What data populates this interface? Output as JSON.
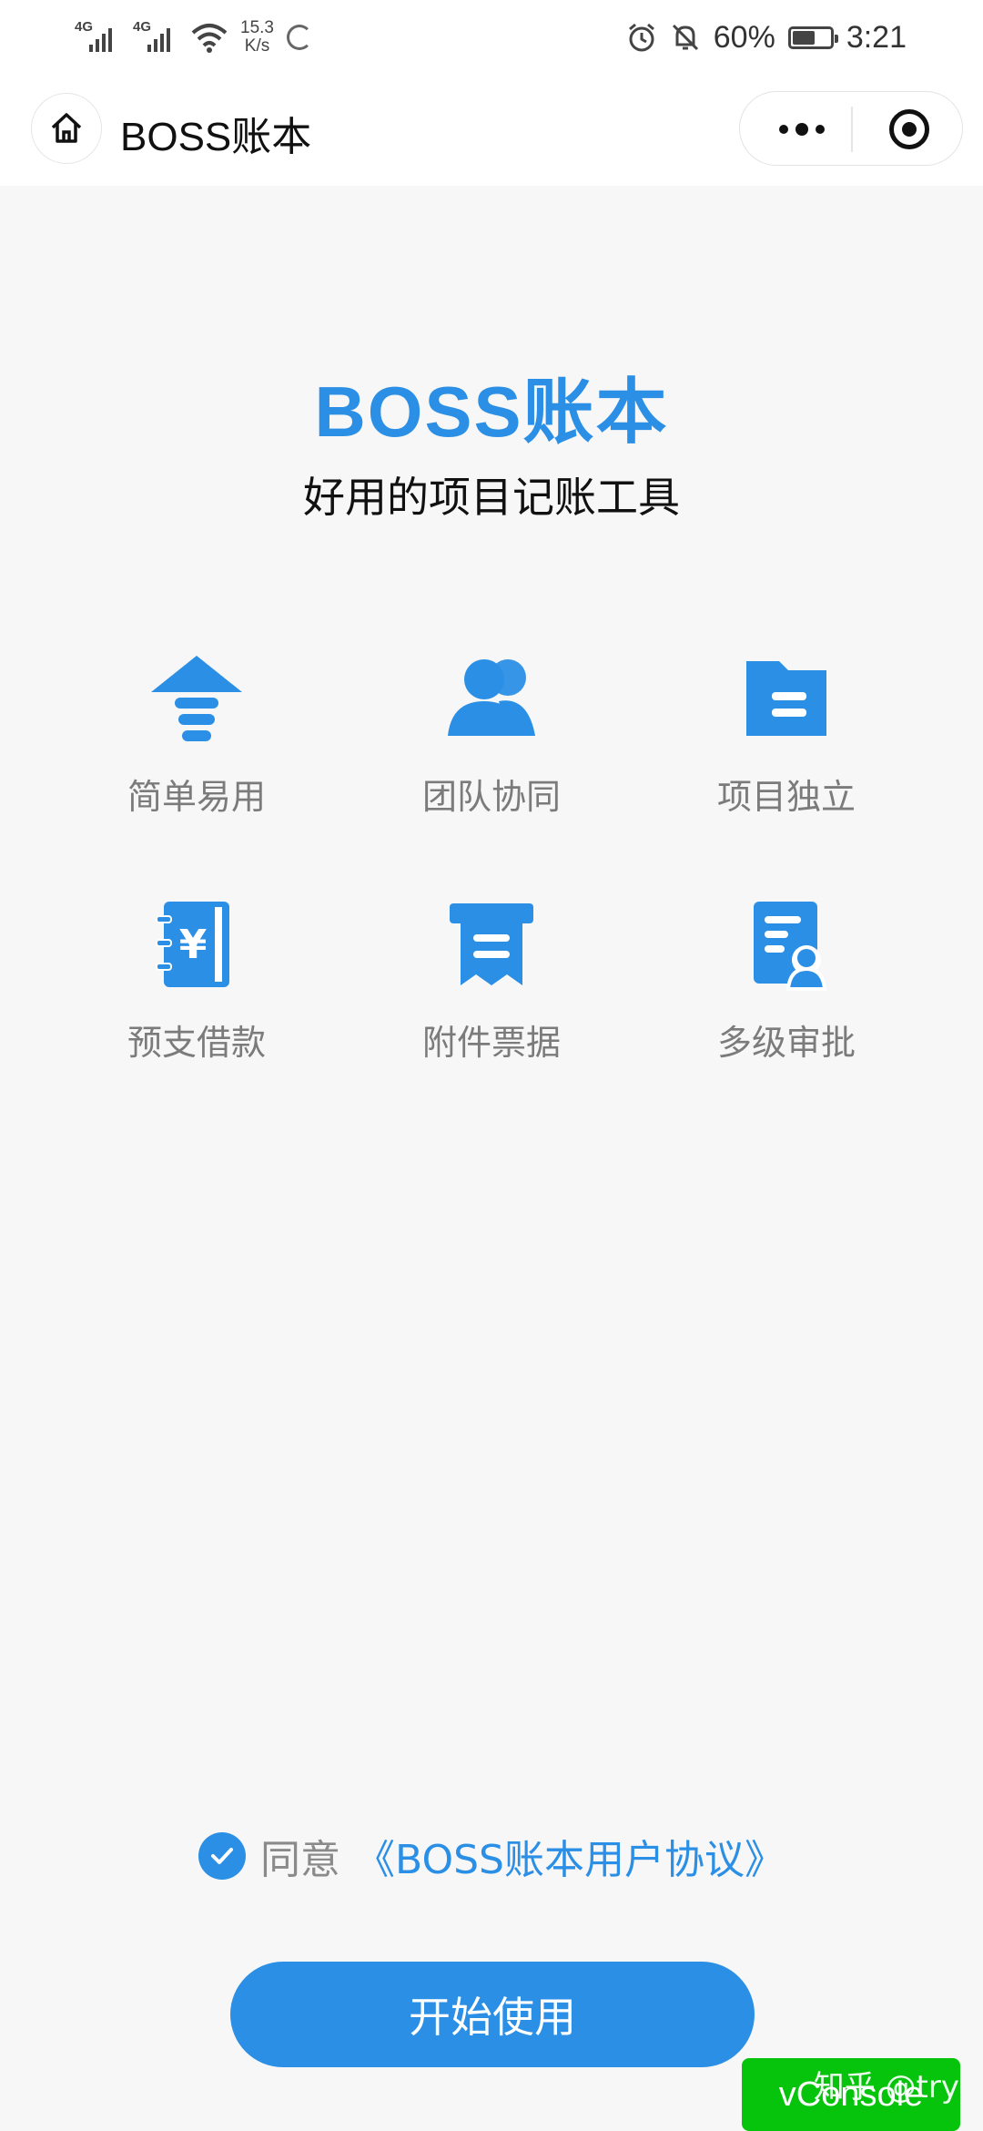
{
  "status_bar": {
    "network_1": "4G",
    "network_2": "4G",
    "speed_value": "15.3",
    "speed_unit": "K/s",
    "battery_percent": "60%",
    "battery_level": 0.6,
    "time": "3:21"
  },
  "nav": {
    "title": "BOSS账本",
    "home_icon": "home-icon",
    "more_icon": "more-dots-icon",
    "close_icon": "target-icon"
  },
  "header": {
    "brand": "BOSS账本",
    "slogan": "好用的项目记账工具"
  },
  "features": [
    {
      "label": "简单易用",
      "icon": "arrow-up-stack-icon"
    },
    {
      "label": "团队协同",
      "icon": "team-icon"
    },
    {
      "label": "项目独立",
      "icon": "folder-icon"
    },
    {
      "label": "预支借款",
      "icon": "yuan-notebook-icon"
    },
    {
      "label": "附件票据",
      "icon": "receipt-icon"
    },
    {
      "label": "多级审批",
      "icon": "document-user-icon"
    }
  ],
  "agreement": {
    "checked": true,
    "prefix": "同意",
    "link": "《BOSS账本用户协议》"
  },
  "start_button": "开始使用",
  "overlay": {
    "vconsole": "vConsole",
    "watermark": "知乎 @try"
  },
  "colors": {
    "accent": "#2b8fe6",
    "vconsole": "#06c40b"
  }
}
